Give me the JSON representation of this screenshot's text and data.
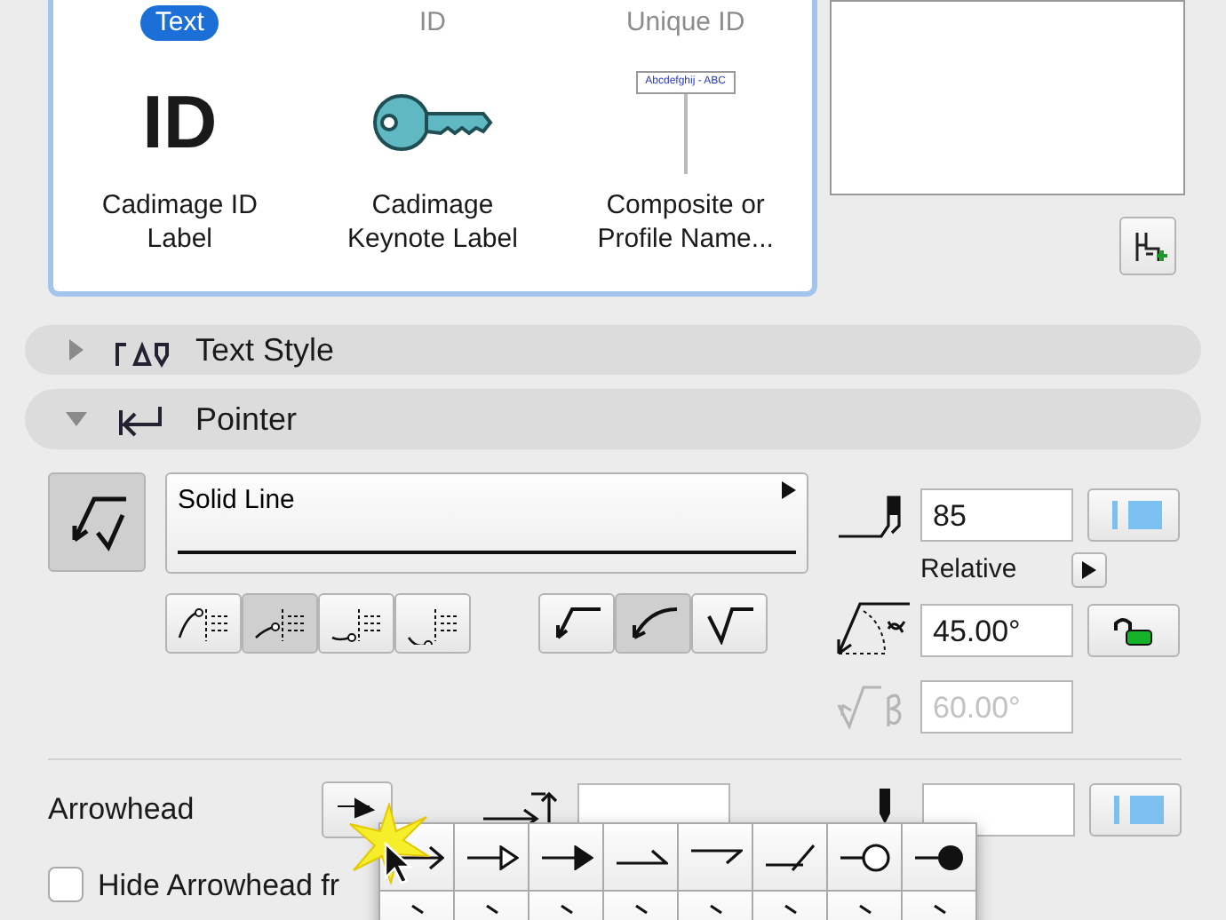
{
  "label_types": {
    "filter_tabs": [
      {
        "label": "Text",
        "selected": true
      },
      {
        "label": "ID",
        "selected": false
      },
      {
        "label": "Unique ID",
        "selected": false
      }
    ],
    "items": [
      {
        "kind": "id",
        "icon_text": "ID",
        "label": "Cadimage ID Label"
      },
      {
        "kind": "key",
        "label": "Cadimage Keynote Label"
      },
      {
        "kind": "sign",
        "sign_text": "Abcdefghij - ABC",
        "label": "Composite or Profile Name..."
      }
    ]
  },
  "sections": [
    {
      "title": "Text Style",
      "expanded": false
    },
    {
      "title": "Pointer",
      "expanded": true
    }
  ],
  "pointer": {
    "line_type": "Solid Line",
    "anchor_options": [
      {
        "selected": false
      },
      {
        "selected": true
      },
      {
        "selected": false
      },
      {
        "selected": false
      }
    ],
    "shape_options": [
      {
        "kind": "straight",
        "selected": false
      },
      {
        "kind": "curved",
        "selected": true
      },
      {
        "kind": "bent",
        "selected": false
      }
    ],
    "pen": "85",
    "angle_mode": "Relative",
    "angle": "45.00°",
    "angle_locked": false,
    "beta": "60.00°",
    "beta_disabled": true
  },
  "arrowhead": {
    "label": "Arrowhead",
    "hide_checkbox": {
      "label": "Hide Arrowhead fr",
      "checked": false
    },
    "picker_rows": [
      [
        {
          "kind": "open"
        },
        {
          "kind": "hollow"
        },
        {
          "kind": "filled"
        },
        {
          "kind": "half-up"
        },
        {
          "kind": "half-down"
        },
        {
          "kind": "slash"
        },
        {
          "kind": "circle-open"
        },
        {
          "kind": "circle-filled"
        }
      ],
      [
        {
          "kind": "tail"
        },
        {
          "kind": "tail"
        },
        {
          "kind": "tail"
        },
        {
          "kind": "tail"
        },
        {
          "kind": "tail"
        },
        {
          "kind": "tail"
        },
        {
          "kind": "tail"
        },
        {
          "kind": "tail"
        }
      ]
    ]
  }
}
